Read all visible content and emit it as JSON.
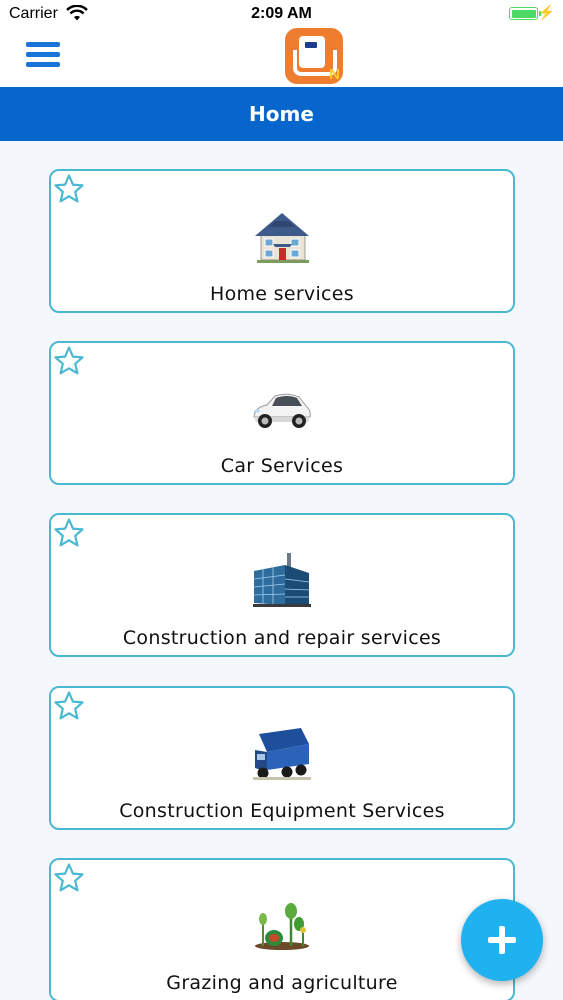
{
  "status_bar": {
    "carrier": "Carrier",
    "time": "2:09 AM",
    "battery_icon": "battery-full-icon",
    "charging_icon": "⚡"
  },
  "nav": {
    "menu_icon": "hamburger-menu-icon",
    "logo_letter": "N"
  },
  "header": {
    "title": "Home"
  },
  "colors": {
    "accent": "#0766cc",
    "card_border": "#4bb8d2",
    "fab": "#1fb2ee",
    "logo": "#ee7d2f"
  },
  "categories": [
    {
      "label": "Home services",
      "icon": "house-icon"
    },
    {
      "label": "Car Services",
      "icon": "car-icon"
    },
    {
      "label": "Construction and repair services",
      "icon": "building-icon"
    },
    {
      "label": "Construction Equipment Services",
      "icon": "truck-icon"
    },
    {
      "label": "Grazing and agriculture",
      "icon": "plants-icon"
    }
  ],
  "fab": {
    "icon": "plus-icon"
  }
}
